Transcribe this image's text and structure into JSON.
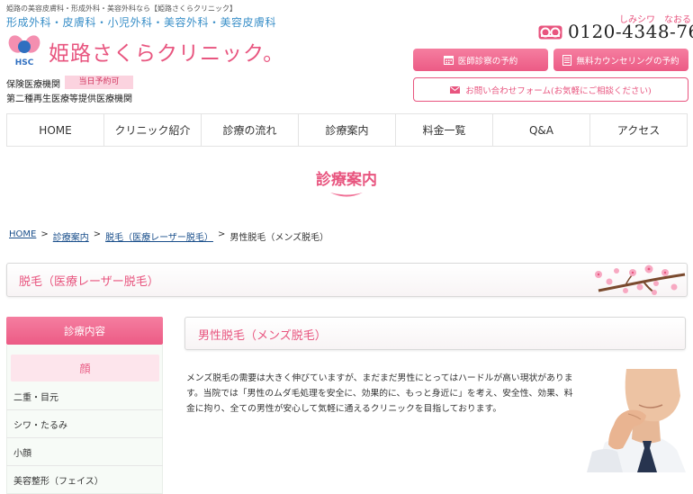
{
  "header": {
    "tagline": "姫路の美容皮膚科・形成外科・美容外科なら【姫路さくらクリニック】",
    "specialties": "形成外科・皮膚科・小児外科・美容外科・美容皮膚科",
    "logo_abbr": "HSC",
    "clinic_name": "姫路さくらクリニック。",
    "insurance": "保険医療機関",
    "same_day_badge": "当日予約可",
    "regenerative": "第二種再生医療等提供医療機関",
    "phone_reading": "しみシワ　なおる",
    "phone_number": "0120-4348-76",
    "btn_doctor": "医師診察の予約",
    "btn_counsel": "無料カウンセリングの予約",
    "btn_contact": "お問い合わせフォーム(お気軽にご相談ください)"
  },
  "nav": {
    "items": [
      "HOME",
      "クリニック紹介",
      "診療の流れ",
      "診療案内",
      "料金一覧",
      "Q&A",
      "アクセス"
    ]
  },
  "page": {
    "section_title": "診療案内"
  },
  "breadcrumb": {
    "home": "HOME",
    "sep": ">",
    "level1": "診療案内",
    "level2": "脱毛（医療レーザー脱毛）",
    "current": "男性脱毛（メンズ脱毛）"
  },
  "category": {
    "title": "脱毛（医療レーザー脱毛）"
  },
  "sidebar": {
    "header": "診療内容",
    "category": "顔",
    "items": [
      "二重・目元",
      "シワ・たるみ",
      "小顔",
      "美容整形（フェイス）"
    ]
  },
  "main": {
    "title": "男性脱毛（メンズ脱毛）",
    "body": "メンズ脱毛の需要は大きく伸びていますが、まだまだ男性にとってはハードルが高い現状があります。当院では「男性のムダ毛処理を安全に、効果的に、もっと身近に」を考え、安全性、効果、料金に拘り、全ての男性が安心して気軽に通えるクリニックを目指しております。"
  },
  "colors": {
    "brand_pink": "#e8557f",
    "button_pink": "#ec5b85",
    "logo_blue": "#3a8fc8"
  },
  "icons": {
    "calendar": "calendar-icon",
    "document": "document-icon",
    "mail": "mail-icon",
    "freedial": "freedial-icon"
  }
}
